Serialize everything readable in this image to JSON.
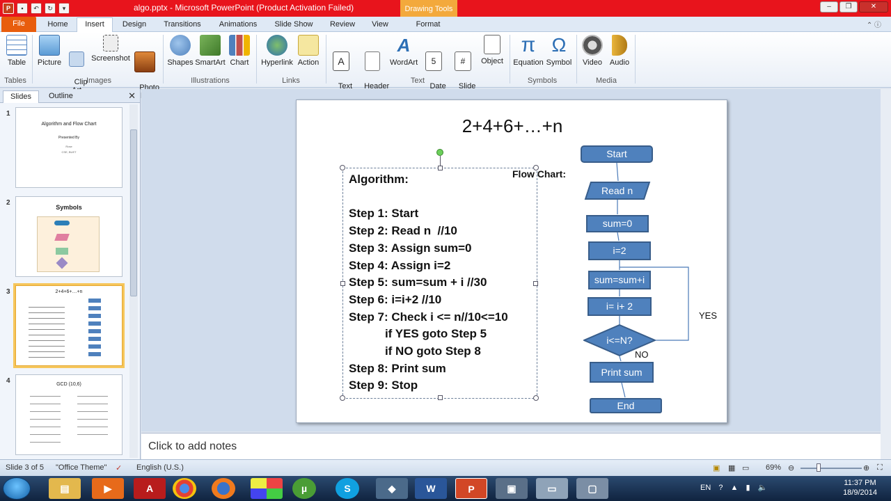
{
  "window": {
    "title": "algo.pptx - Microsoft PowerPoint (Product Activation Failed)",
    "context_tab": "Drawing Tools"
  },
  "tabs": [
    "File",
    "Home",
    "Insert",
    "Design",
    "Transitions",
    "Animations",
    "Slide Show",
    "Review",
    "View",
    "Format"
  ],
  "ribbon": {
    "tables": {
      "group": "Tables",
      "buttons": [
        "Table"
      ]
    },
    "images": {
      "group": "Images",
      "buttons": [
        "Picture",
        "Clip\nArt",
        "Screenshot",
        "Photo\nAlbum"
      ]
    },
    "illustrations": {
      "group": "Illustrations",
      "buttons": [
        "Shapes",
        "SmartArt",
        "Chart"
      ]
    },
    "links": {
      "group": "Links",
      "buttons": [
        "Hyperlink",
        "Action"
      ]
    },
    "text": {
      "group": "Text",
      "buttons": [
        "Text\nBox",
        "Header\n& Footer",
        "WordArt",
        "Date\n& Time",
        "Slide\nNumber",
        "Object"
      ]
    },
    "symbols": {
      "group": "Symbols",
      "buttons": [
        "Equation",
        "Symbol"
      ]
    },
    "media": {
      "group": "Media",
      "buttons": [
        "Video",
        "Audio"
      ]
    }
  },
  "panel": {
    "tabs": [
      "Slides",
      "Outline"
    ],
    "slides": [
      {
        "num": "1",
        "title": "Algorithm and Flow Chart",
        "lines": [
          "Presented By",
          "Rose",
          "CSE, BUET"
        ]
      },
      {
        "num": "2",
        "title": "Symbols"
      },
      {
        "num": "3",
        "title": "2+4+6+…+n"
      },
      {
        "num": "4",
        "title": "GCD (10,6)"
      }
    ]
  },
  "slide": {
    "title": "2+4+6+…+n",
    "algorithm": [
      "Algorithm:",
      "",
      "Step 1: Start",
      "Step 2: Read n  //10",
      "Step 3: Assign sum=0",
      "Step 4: Assign i=2",
      "Step 5: sum=sum + i //30",
      "Step 6: i=i+2 //10",
      "Step 7: Check i <= n//10<=10",
      "           if YES goto Step 5",
      "           if NO goto Step 8",
      "Step 8: Print sum",
      "Step 9: Stop"
    ],
    "flow_chart_label": "Flow Chart:",
    "flow": {
      "start": "Start",
      "read": "Read n",
      "sum0": "sum=0",
      "i2": "i=2",
      "sumi": "sum=sum+i",
      "inc": "i= i+ 2",
      "decision": "i<=N?",
      "print": "Print sum",
      "end": "End",
      "yes": "YES",
      "no": "NO"
    }
  },
  "notes": {
    "placeholder": "Click to add notes"
  },
  "status": {
    "slide": "Slide 3 of 5",
    "theme": "\"Office Theme\"",
    "language": "English (U.S.)",
    "zoom": "69%"
  },
  "taskbar": {
    "lang": "EN",
    "time": "11:37 PM",
    "date": "18/9/2014"
  }
}
